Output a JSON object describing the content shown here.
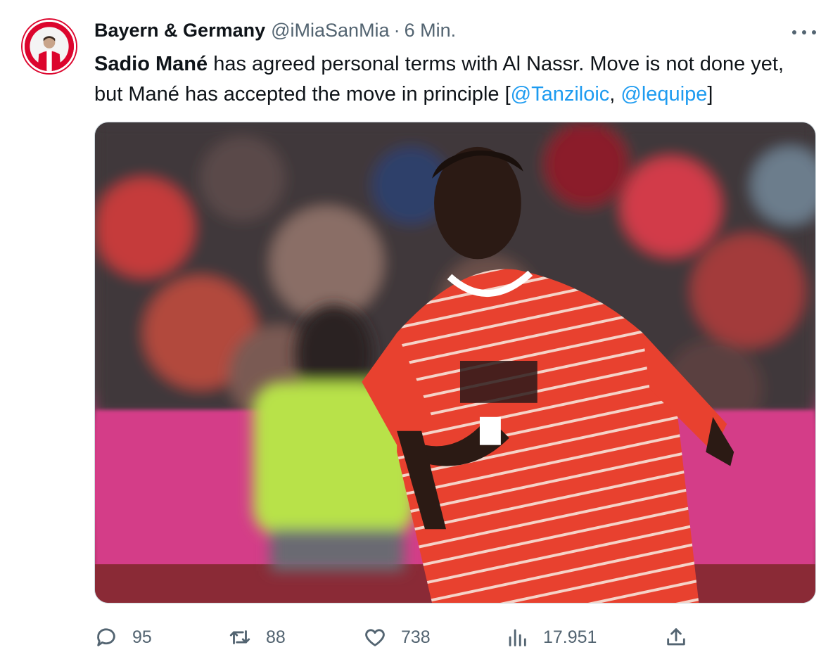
{
  "author": {
    "display_name": "Bayern & Germany",
    "handle": "@iMiaSanMia",
    "separator": "·",
    "time": "6 Min."
  },
  "tweet": {
    "bold_name": "Sadio Mané",
    "text_part1": " has agreed personal terms with Al Nassr. Move is not done yet, but Mané has accepted the move in principle [",
    "mention1": "@Tanziloic",
    "sep": ", ",
    "mention2": "@lequipe",
    "close": "]"
  },
  "actions": {
    "reply_count": "95",
    "retweet_count": "88",
    "like_count": "738",
    "views_count": "17.951"
  },
  "icons": {
    "more": "more-icon",
    "reply": "reply-icon",
    "retweet": "retweet-icon",
    "like": "like-icon",
    "views": "views-icon",
    "share": "share-icon"
  },
  "colors": {
    "link": "#1d9bf0",
    "secondary_text": "#536471",
    "bayern_red": "#dc052d"
  }
}
